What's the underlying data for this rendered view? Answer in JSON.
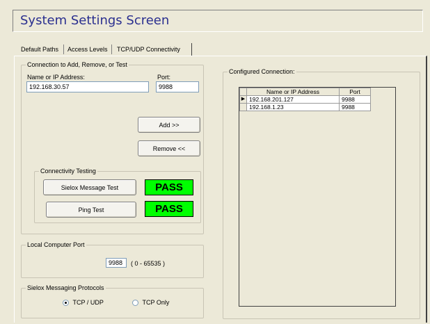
{
  "header": {
    "title": "System Settings Screen"
  },
  "tabs": [
    {
      "label": "Default Paths"
    },
    {
      "label": "Access Levels"
    },
    {
      "label": "TCP/UDP Connectivity"
    }
  ],
  "connection_group": {
    "legend": "Connection to Add, Remove, or Test",
    "address_label": "Name or IP Address:",
    "address_value": "192.168.30.57",
    "port_label": "Port:",
    "port_value": "9988",
    "add_label": "Add >>",
    "remove_label": "Remove <<"
  },
  "connectivity_testing": {
    "legend": "Connectivity Testing",
    "message_test_label": "Sielox Message Test",
    "message_test_result": "PASS",
    "ping_test_label": "Ping Test",
    "ping_test_result": "PASS",
    "result_color": "#00ff00"
  },
  "local_port": {
    "legend": "Local Computer Port",
    "value": "9988",
    "range": "( 0 - 65535 )"
  },
  "protocols": {
    "legend": "Sielox Messaging Protocols",
    "options": [
      {
        "label": "TCP / UDP",
        "selected": true
      },
      {
        "label": "TCP Only",
        "selected": false
      }
    ]
  },
  "configured": {
    "legend": "Configured Connection:",
    "columns": [
      "Name or IP Address",
      "Port"
    ],
    "rows": [
      {
        "address": "192.168.201.127",
        "port": "9988",
        "current": true
      },
      {
        "address": "192.168.1.23",
        "port": "9988",
        "current": false
      }
    ]
  }
}
